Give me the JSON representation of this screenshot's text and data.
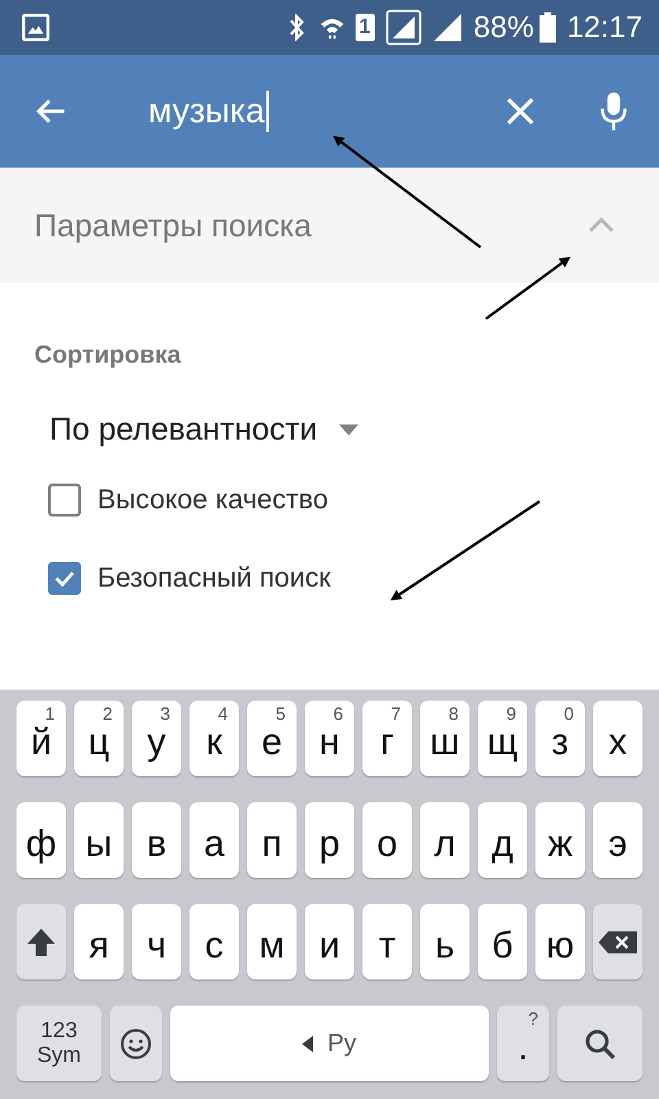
{
  "status_bar": {
    "sim": "1",
    "battery": "88%",
    "time": "12:17"
  },
  "search_bar": {
    "value": "музыка"
  },
  "filters": {
    "title": "Параметры поиска",
    "expanded": true
  },
  "sort": {
    "label": "Сортировка",
    "value": "По релевантности"
  },
  "options": [
    {
      "label": "Высокое качество",
      "checked": false
    },
    {
      "label": "Безопасный поиск",
      "checked": true
    }
  ],
  "keyboard": {
    "rows": [
      [
        {
          "kind": "char",
          "label": "й",
          "hint": "1"
        },
        {
          "kind": "char",
          "label": "ц",
          "hint": "2"
        },
        {
          "kind": "char",
          "label": "у",
          "hint": "3"
        },
        {
          "kind": "char",
          "label": "к",
          "hint": "4"
        },
        {
          "kind": "char",
          "label": "е",
          "hint": "5"
        },
        {
          "kind": "char",
          "label": "н",
          "hint": "6"
        },
        {
          "kind": "char",
          "label": "г",
          "hint": "7"
        },
        {
          "kind": "char",
          "label": "ш",
          "hint": "8"
        },
        {
          "kind": "char",
          "label": "щ",
          "hint": "9"
        },
        {
          "kind": "char",
          "label": "з",
          "hint": "0"
        },
        {
          "kind": "char",
          "label": "х"
        }
      ],
      [
        {
          "kind": "char",
          "label": "ф"
        },
        {
          "kind": "char",
          "label": "ы"
        },
        {
          "kind": "char",
          "label": "в"
        },
        {
          "kind": "char",
          "label": "а"
        },
        {
          "kind": "char",
          "label": "п"
        },
        {
          "kind": "char",
          "label": "р"
        },
        {
          "kind": "char",
          "label": "о"
        },
        {
          "kind": "char",
          "label": "л"
        },
        {
          "kind": "char",
          "label": "д"
        },
        {
          "kind": "char",
          "label": "ж"
        },
        {
          "kind": "char",
          "label": "э"
        }
      ],
      [
        {
          "kind": "shift"
        },
        {
          "kind": "char",
          "label": "я"
        },
        {
          "kind": "char",
          "label": "ч"
        },
        {
          "kind": "char",
          "label": "с"
        },
        {
          "kind": "char",
          "label": "м"
        },
        {
          "kind": "char",
          "label": "и"
        },
        {
          "kind": "char",
          "label": "т"
        },
        {
          "kind": "char",
          "label": "ь"
        },
        {
          "kind": "char",
          "label": "б"
        },
        {
          "kind": "char",
          "label": "ю"
        },
        {
          "kind": "backspace"
        }
      ],
      [
        {
          "kind": "symbols",
          "label": "123",
          "sublabel": "Sym"
        },
        {
          "kind": "emoji"
        },
        {
          "kind": "space",
          "label": "Ру"
        },
        {
          "kind": "period",
          "label": ".",
          "hint": "?"
        },
        {
          "kind": "search"
        }
      ]
    ]
  }
}
